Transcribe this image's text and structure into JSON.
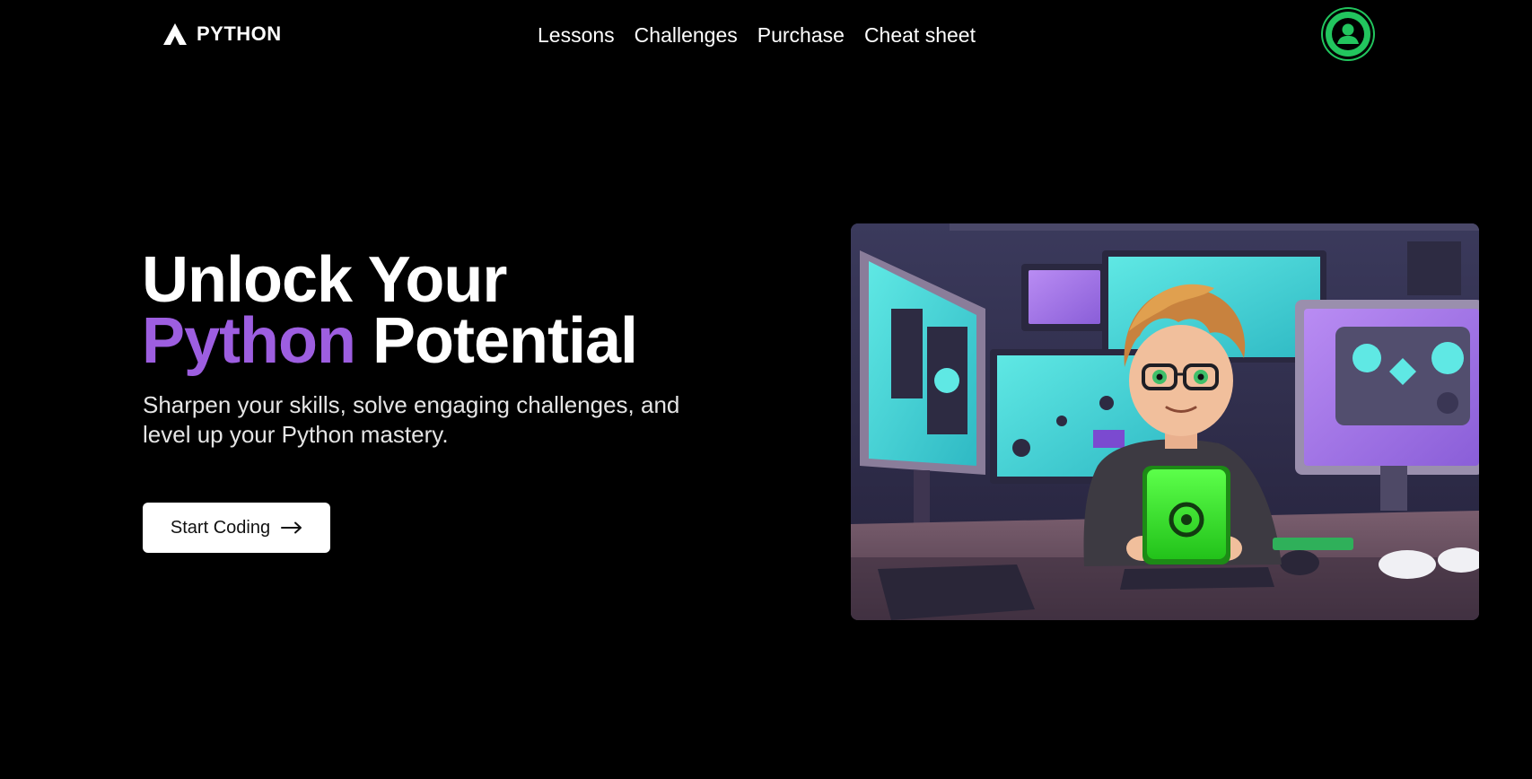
{
  "header": {
    "brand": "PYTHON",
    "brand_icon": "triangle-logo-icon",
    "nav": [
      {
        "label": "Lessons"
      },
      {
        "label": "Challenges"
      },
      {
        "label": "Purchase"
      },
      {
        "label": "Cheat sheet"
      }
    ],
    "avatar_icon": "user-icon"
  },
  "hero": {
    "title_line1": "Unlock Your",
    "title_accent": "Python",
    "title_rest": "Potential",
    "subtitle": "Sharpen your skills, solve engaging challenges, and level up your Python mastery.",
    "cta_label": "Start Coding",
    "cta_icon": "arrow-right-icon",
    "image_subject": "cartoon-programmer-illustration"
  },
  "colors": {
    "background": "#000000",
    "accent_purple": "#9d5ee0",
    "avatar_green": "#22c55e",
    "cta_background": "#ffffff",
    "text": "#ffffff"
  }
}
